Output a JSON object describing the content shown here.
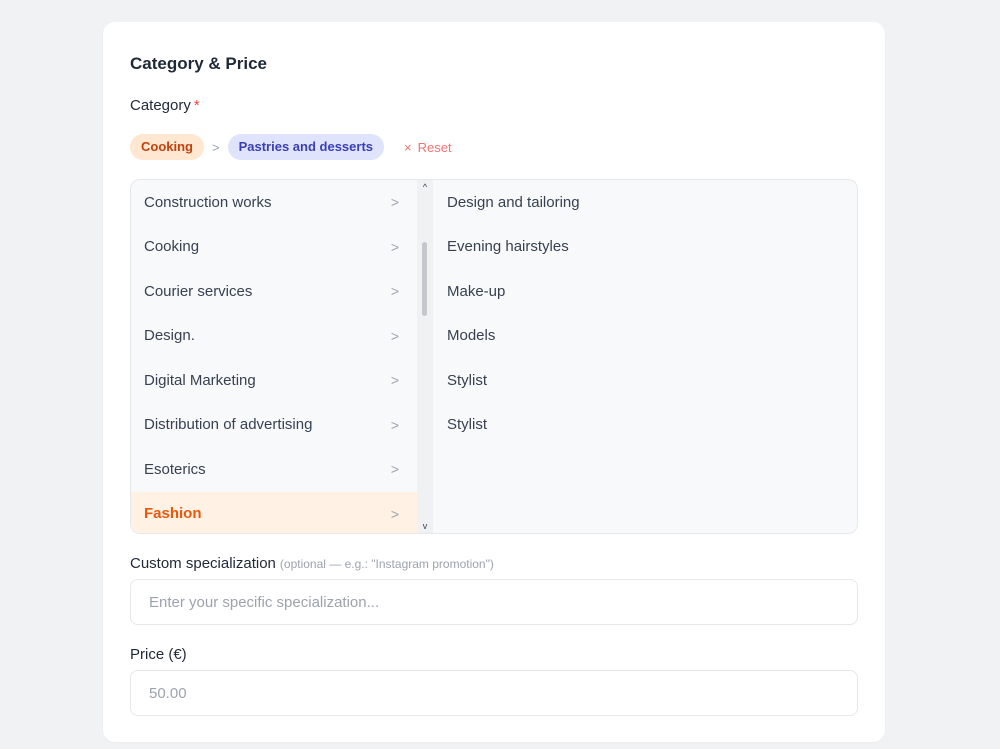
{
  "section": {
    "title": "Category & Price"
  },
  "category": {
    "label": "Category",
    "required_mark": "*",
    "breadcrumb": {
      "primary": "Cooking",
      "separator": ">",
      "secondary": "Pastries and desserts",
      "reset_icon": "×",
      "reset_label": "Reset"
    },
    "left_items": [
      {
        "label": "Construction works",
        "chevron": ">"
      },
      {
        "label": "Cooking",
        "chevron": ">"
      },
      {
        "label": "Courier services",
        "chevron": ">"
      },
      {
        "label": "Design.",
        "chevron": ">"
      },
      {
        "label": "Digital Marketing",
        "chevron": ">"
      },
      {
        "label": "Distribution of advertising",
        "chevron": ">"
      },
      {
        "label": "Esoterics",
        "chevron": ">"
      },
      {
        "label": "Fashion",
        "chevron": ">"
      }
    ],
    "active_left": "Fashion",
    "right_items": [
      "Design and tailoring",
      "Evening hairstyles",
      "Make-up",
      "Models",
      "Stylist",
      "Stylist"
    ],
    "scroll_up": "^",
    "scroll_down": "v"
  },
  "custom": {
    "label": "Custom specialization",
    "hint": "(optional — e.g.: \"Instagram promotion\")",
    "placeholder": "Enter your specific specialization..."
  },
  "price": {
    "label": "Price (€)",
    "value": "50.00"
  },
  "colors": {
    "accent": "#ea580c",
    "chip_primary_bg": "#ffe7d2",
    "chip_secondary_bg": "#dfe3fb",
    "reset": "#f87171",
    "required": "#ef4444"
  }
}
